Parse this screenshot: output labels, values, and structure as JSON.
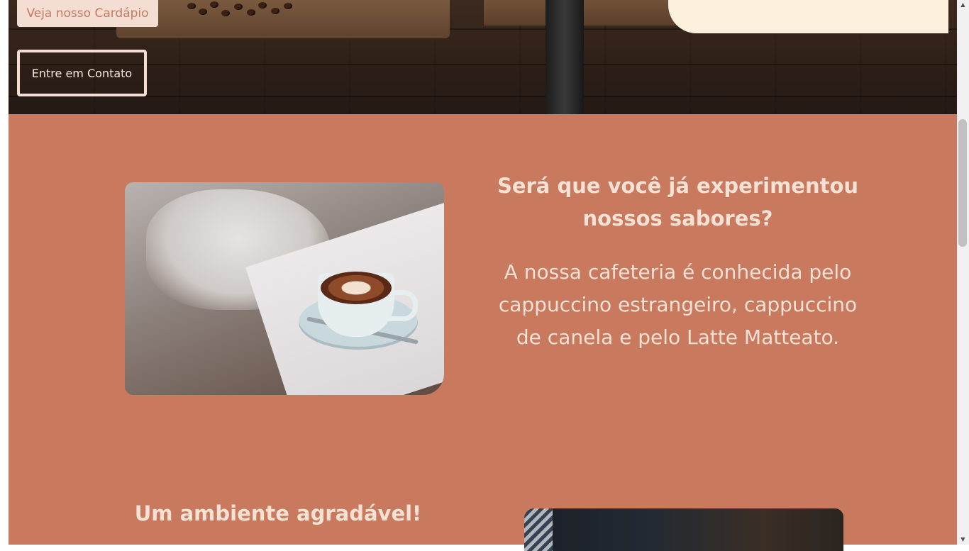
{
  "hero": {
    "menu_button_label": "Veja nosso Cardápio",
    "contact_button_label": "Entre em Contato"
  },
  "section_flavors": {
    "title": "Será que você já experimentou nossos sabores?",
    "text": "A nossa cafeteria é conhecida pelo cappuccino estrangeiro, cappuccino de canela e pelo Latte Matteato."
  },
  "section_ambience": {
    "title": "Um ambiente agradável!"
  },
  "colors": {
    "section_background": "#c8795e",
    "text_light": "#f6e1d5",
    "button_fill": "#f4ddd2",
    "cream_card": "#fdf0dc"
  },
  "scrollbar": {
    "up_arrow_icon": "triangle-up",
    "down_arrow_icon": "triangle-down"
  }
}
